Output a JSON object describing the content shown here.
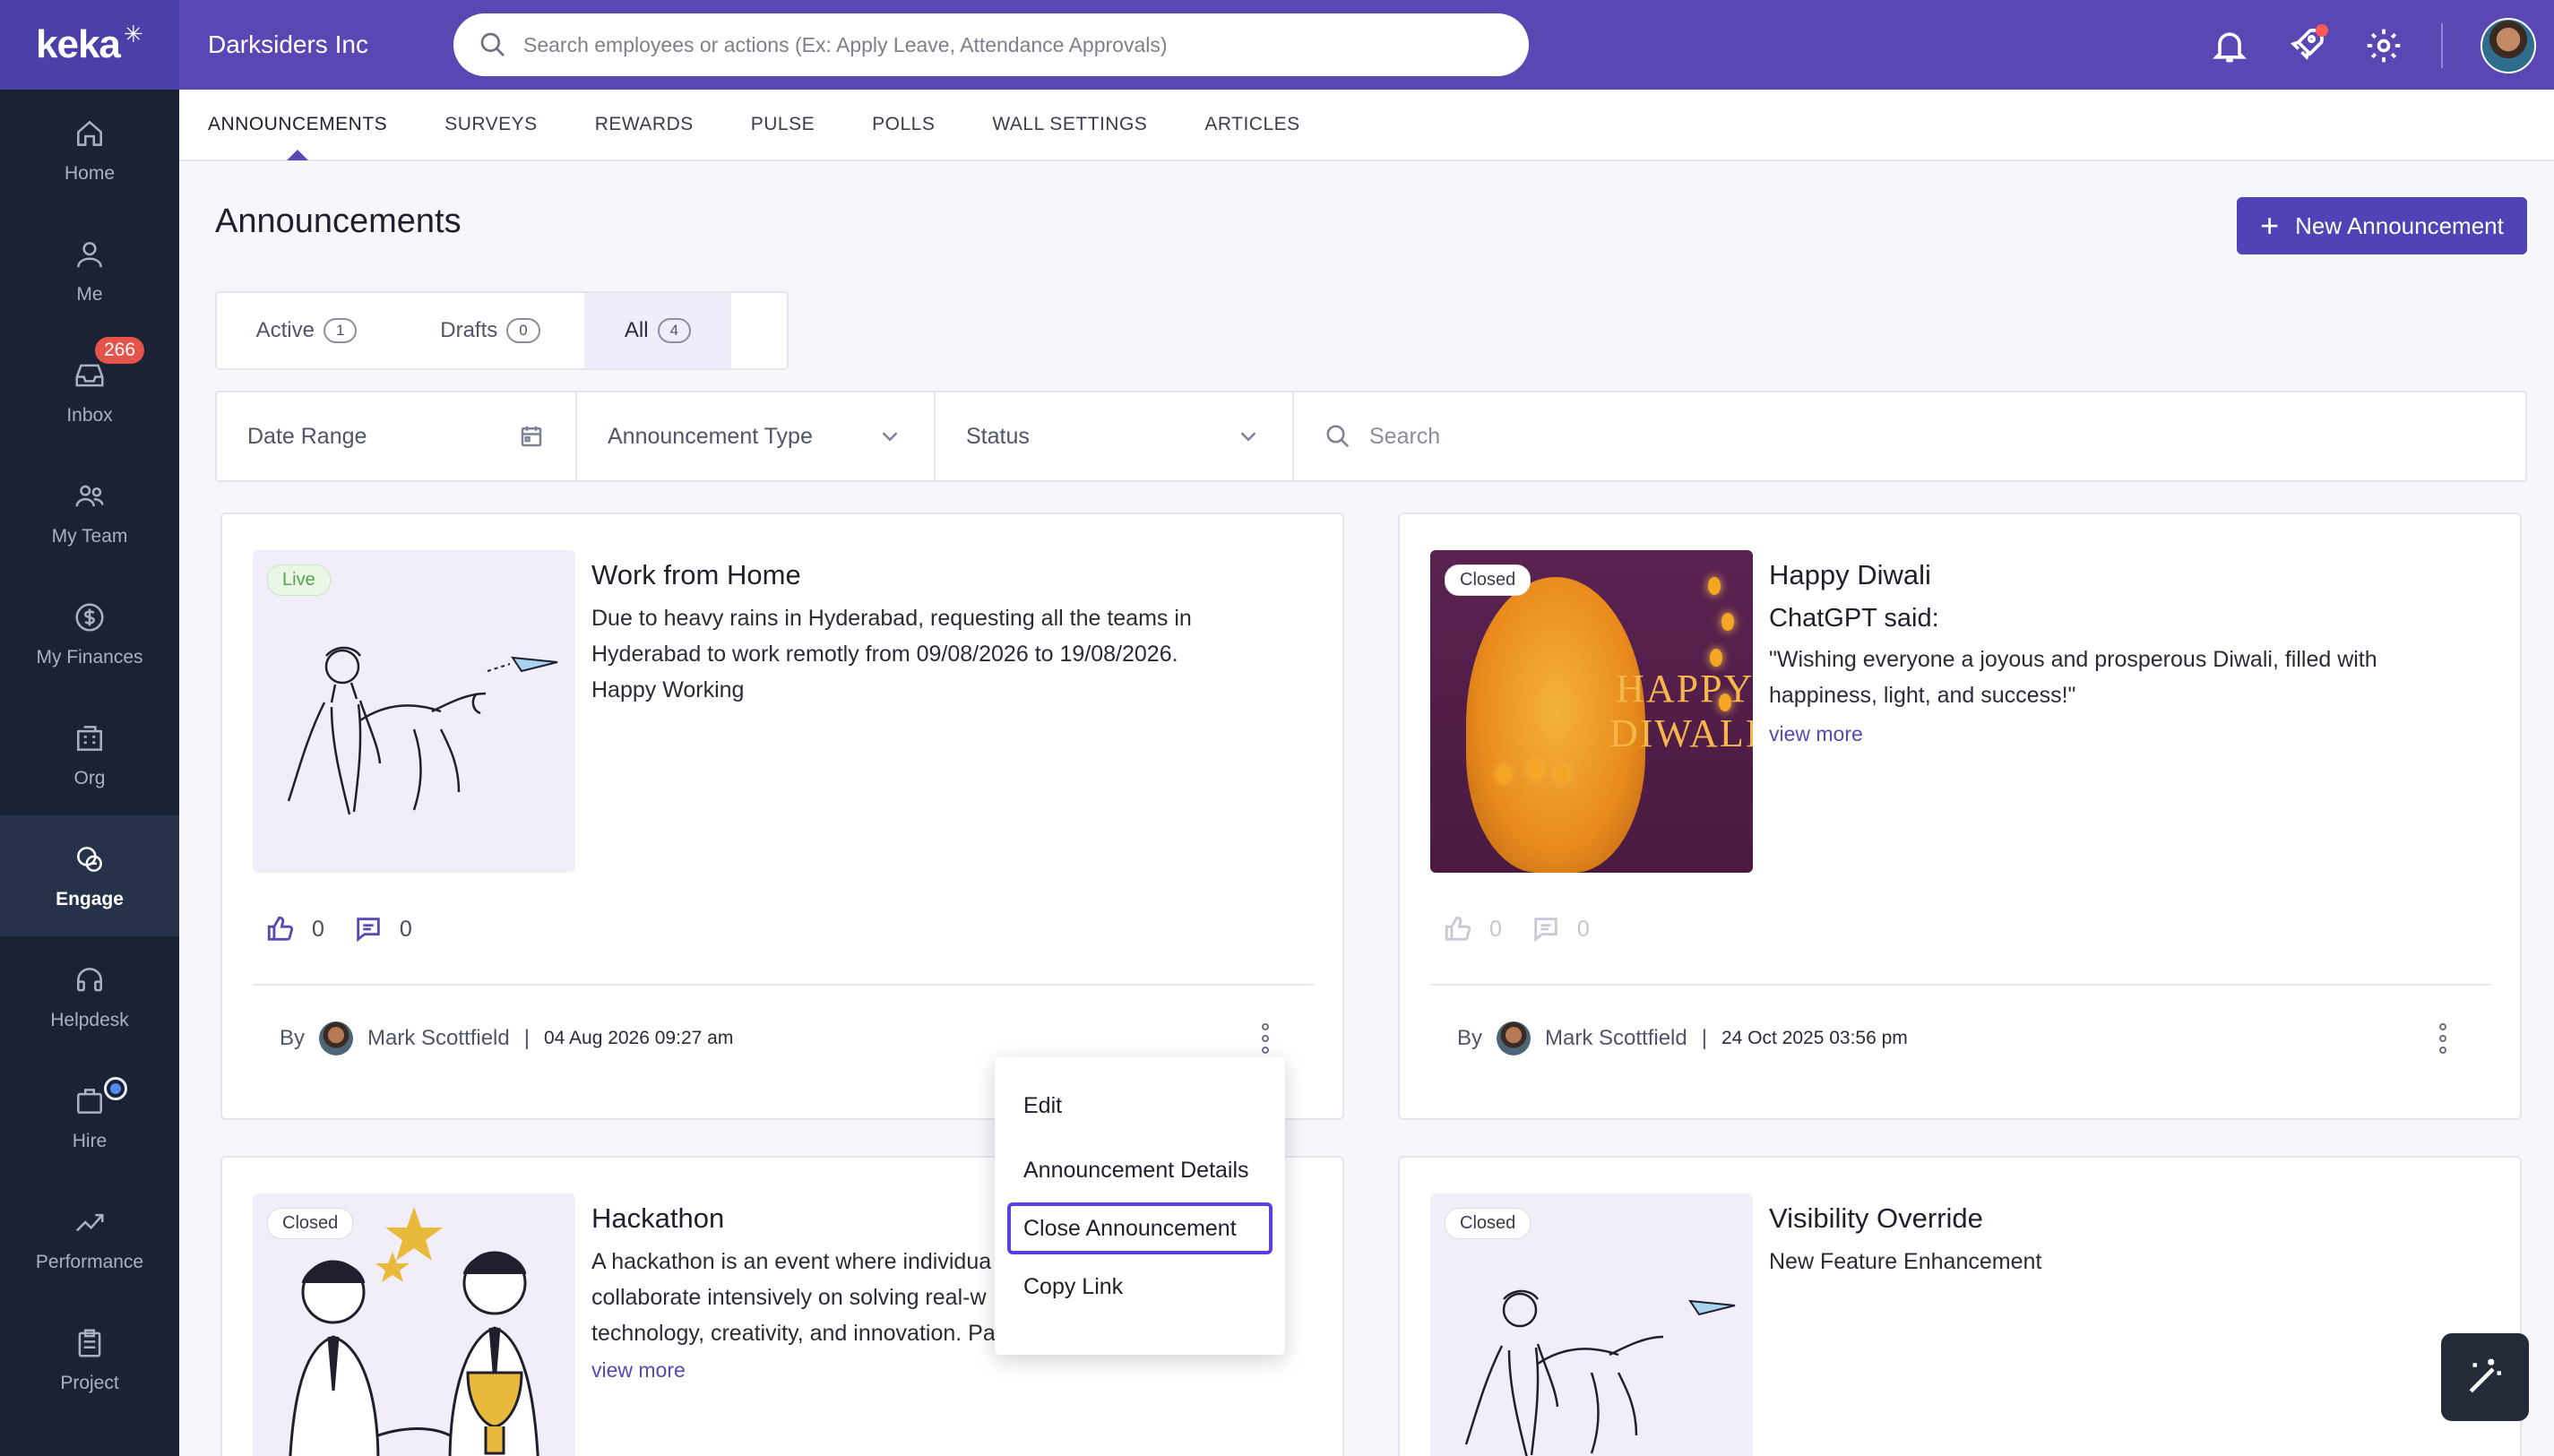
{
  "app": {
    "logo_text": "keka",
    "company": "Darksiders Inc"
  },
  "search": {
    "placeholder": "Search employees or actions (Ex: Apply Leave, Attendance Approvals)"
  },
  "sidebar": {
    "items": [
      {
        "label": "Home",
        "icon": "home-icon"
      },
      {
        "label": "Me",
        "icon": "user-icon"
      },
      {
        "label": "Inbox",
        "icon": "inbox-icon",
        "badge": "266"
      },
      {
        "label": "My Team",
        "icon": "team-icon"
      },
      {
        "label": "My Finances",
        "icon": "dollar-icon"
      },
      {
        "label": "Org",
        "icon": "org-icon"
      },
      {
        "label": "Engage",
        "icon": "engage-icon",
        "active": true
      },
      {
        "label": "Helpdesk",
        "icon": "headset-icon"
      },
      {
        "label": "Hire",
        "icon": "briefcase-icon"
      },
      {
        "label": "Performance",
        "icon": "trend-icon"
      },
      {
        "label": "Project",
        "icon": "clipboard-icon"
      }
    ]
  },
  "subnav": {
    "tabs": [
      "ANNOUNCEMENTS",
      "SURVEYS",
      "REWARDS",
      "PULSE",
      "POLLS",
      "WALL SETTINGS",
      "ARTICLES"
    ],
    "active": "ANNOUNCEMENTS"
  },
  "page": {
    "title": "Announcements",
    "new_button": "New Announcement"
  },
  "filter_tabs": [
    {
      "label": "Active",
      "count": "1"
    },
    {
      "label": "Drafts",
      "count": "0"
    },
    {
      "label": "All",
      "count": "4"
    }
  ],
  "filters": {
    "date_range": "Date Range",
    "type": "Announcement Type",
    "status": "Status",
    "search_placeholder": "Search"
  },
  "cards": [
    {
      "status": "Live",
      "title": "Work from Home",
      "body_lines": [
        "Due to heavy rains in Hyderabad, requesting all the teams in",
        "Hyderabad to work remotly from 09/08/2026 to 19/08/2026.",
        "Happy Working"
      ],
      "likes": "0",
      "comments": "0",
      "by": "By",
      "author": "Mark Scottfield",
      "date": "04 Aug 2026 09:27 am"
    },
    {
      "status": "Closed",
      "title": "Happy Diwali",
      "subtitle": "ChatGPT said:",
      "body_lines": [
        "\"Wishing everyone a joyous and prosperous Diwali, filled with",
        "happiness, light, and success!\""
      ],
      "view_more": "view more",
      "likes": "0",
      "comments": "0",
      "by": "By",
      "author": "Mark Scottfield",
      "date": "24 Oct 2025 03:56 pm",
      "image_text": [
        "HAPPY",
        "DIWALI"
      ]
    },
    {
      "status": "Closed",
      "title": "Hackathon",
      "body_lines": [
        "A hackathon is an event where individua",
        "collaborate intensively on solving real-w",
        "technology, creativity, and innovation. Pa"
      ],
      "view_more": "view more"
    },
    {
      "status": "Closed",
      "title": "Visibility Override",
      "body_lines": [
        "New Feature Enhancement"
      ]
    }
  ],
  "menu": {
    "items": [
      "Edit",
      "Announcement Details",
      "Close Announcement",
      "Copy Link"
    ],
    "highlighted": "Close Announcement"
  },
  "colors": {
    "brand": "#5a47b3",
    "sidebar": "#1a2233",
    "badge": "#e5534b",
    "live": "#5aa24f"
  }
}
